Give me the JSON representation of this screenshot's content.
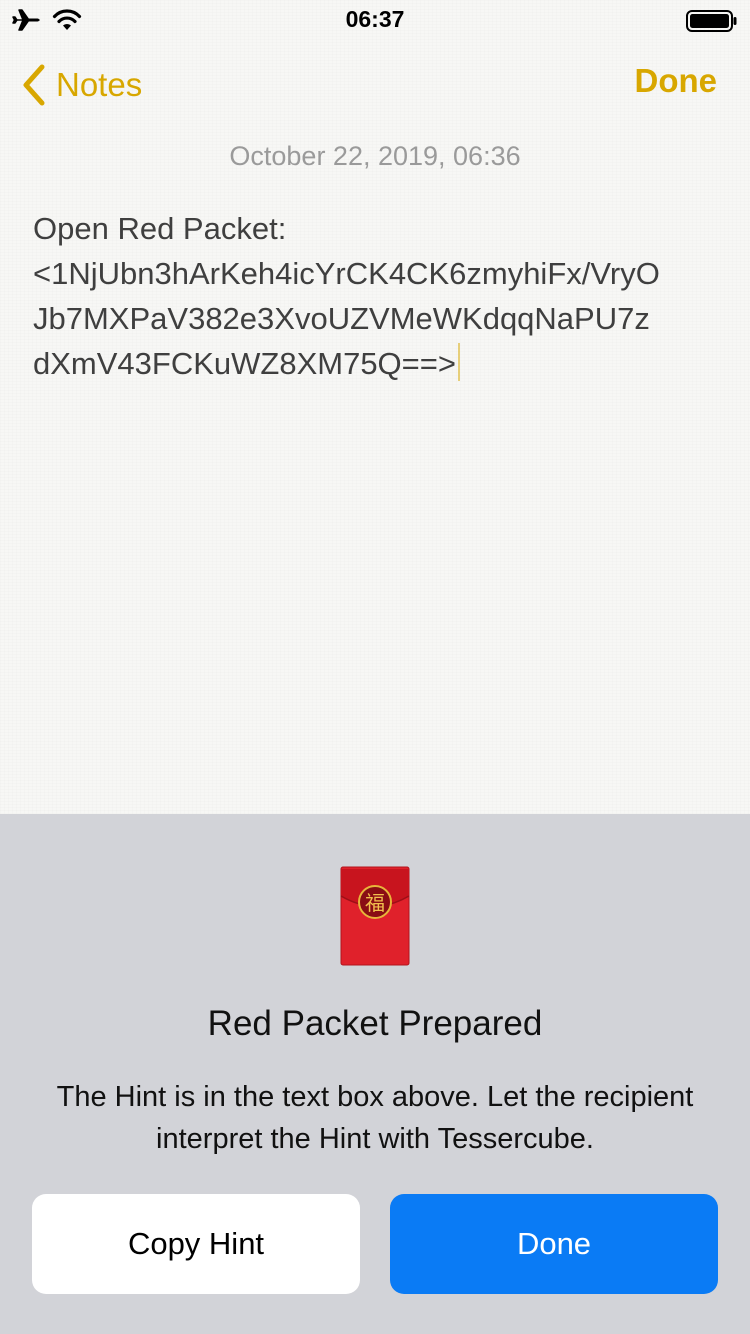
{
  "status_bar": {
    "time": "06:37",
    "icons": [
      "airplane-icon",
      "wifi-icon",
      "battery-icon"
    ]
  },
  "nav": {
    "back_label": "Notes",
    "done_label": "Done"
  },
  "note": {
    "date": "October 22, 2019, 06:36",
    "lines": [
      "Open Red Packet:",
      "<1NjUbn3hArKeh4icYrCK4CK6zmyhiFx/VryO",
      "Jb7MXPaV382e3XvoUZVMeWKdqqNaPU7z",
      "dXmV43FCKuWZ8XM75Q==>"
    ]
  },
  "sheet": {
    "icon": "red-packet-icon",
    "icon_character": "福",
    "title": "Red Packet Prepared",
    "message": "The Hint is in the text box above. Let the recipient interpret the Hint with Tessercube.",
    "copy_button": "Copy Hint",
    "done_button": "Done"
  },
  "colors": {
    "accent_yellow": "#d8a700",
    "primary_blue": "#0a7bf5",
    "sheet_background": "#d2d3d8",
    "packet_red": "#e0212b"
  }
}
